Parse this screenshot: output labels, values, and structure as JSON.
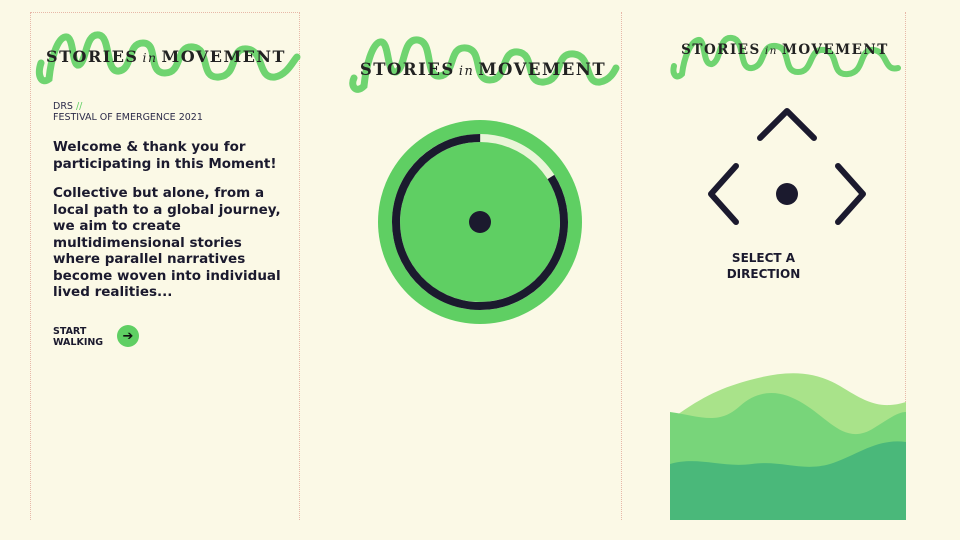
{
  "app": {
    "logo": {
      "word1": "STORIES",
      "word2": "in",
      "word3": "MOVEMENT"
    },
    "intro_panel": {
      "org": "DRS",
      "org_separator": "//",
      "event": "FESTIVAL OF EMERGENCE 2021",
      "welcome": "Welcome & thank you for participating in this Moment!",
      "body": "Collective but alone, from a local path to a global journey, we aim to create multidimensional stories where parallel narratives become woven into individual lived realities...",
      "start_line1": "START",
      "start_line2": "WALKING",
      "start_icon": "arrow-right-icon"
    },
    "progress_panel": {
      "progress_fraction": 0.84
    },
    "direction_panel": {
      "label_line1": "SELECT A",
      "label_line2": "DIRECTION",
      "icons": [
        "chevron-up-icon",
        "chevron-left-icon",
        "chevron-right-icon",
        "position-dot-icon"
      ]
    },
    "colors": {
      "background": "#fbf9e6",
      "accent_green": "#5fcf63",
      "light_green": "#a9e38a",
      "teal_green": "#4ab87a",
      "ink": "#1b1a2e"
    }
  }
}
